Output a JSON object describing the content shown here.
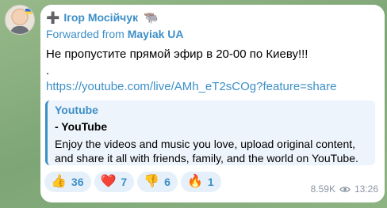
{
  "sender": {
    "prefix": "➕",
    "name": "Ігор Мосійчук",
    "emoji": "🐃"
  },
  "forwarded": {
    "label": "Forwarded from",
    "source": "Mayiak UA"
  },
  "message": {
    "text": "Не пропустите прямой эфир в 20-00 по Киеву!!!",
    "dot": ".",
    "link": "https://youtube.com/live/AMh_eT2sCOg?feature=share"
  },
  "link_preview": {
    "site": "Youtube",
    "title": "- YouTube",
    "description": "Enjoy the videos and music you love, upload original content, and share it all with friends, family, and the world on YouTube."
  },
  "reactions": [
    {
      "emoji": "👍",
      "count": "36"
    },
    {
      "emoji": "❤️",
      "count": "7"
    },
    {
      "emoji": "👎",
      "count": "6"
    },
    {
      "emoji": "🔥",
      "count": "1"
    }
  ],
  "meta": {
    "views": "8.59K",
    "time": "13:26"
  },
  "colors": {
    "accent": "#3c8fc7",
    "bubble": "#ffffff",
    "preview_bg": "#edf4fb",
    "reaction_bg": "#e5f0fa",
    "meta_text": "#8a96a3"
  }
}
